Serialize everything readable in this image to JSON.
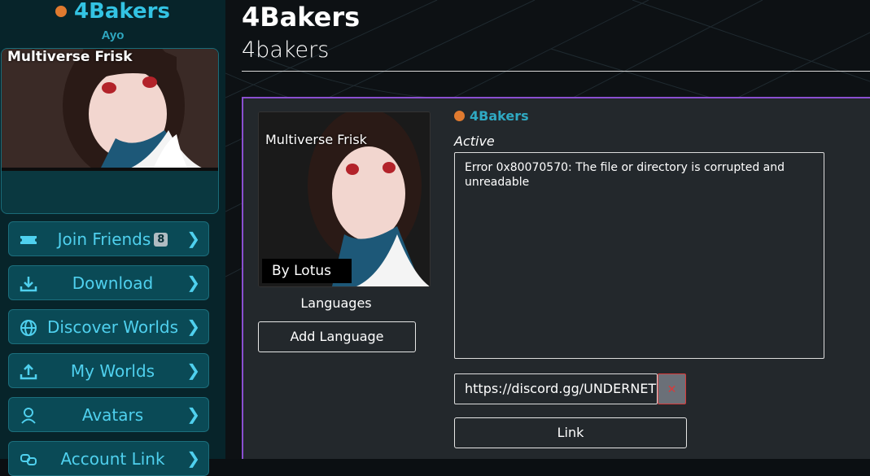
{
  "sidebar": {
    "user_name": "4Bakers",
    "status_text": "Ayo",
    "status_color": "#e07a2f",
    "avatar_name": "Multiverse Frisk",
    "nav": [
      {
        "label": "Join Friends",
        "icon": "ticket-icon",
        "badge": "8"
      },
      {
        "label": "Download",
        "icon": "download-icon"
      },
      {
        "label": "Discover Worlds",
        "icon": "globe-icon"
      },
      {
        "label": "My Worlds",
        "icon": "upload-icon"
      },
      {
        "label": "Avatars",
        "icon": "avatar-icon"
      },
      {
        "label": "Account Link",
        "icon": "link-icon"
      }
    ]
  },
  "main": {
    "title": "4Bakers",
    "subtitle": "4bakers",
    "panel": {
      "thumbnail_title": "Multiverse Frisk",
      "thumbnail_credit": "By Lotus",
      "languages_label": "Languages",
      "add_language_label": "Add Language",
      "display_name": "4Bakers",
      "status": "Active",
      "bio": "Error 0x80070570: The file or directory is corrupted and unreadable",
      "link_value": "https://discord.gg/UNDERNET",
      "link_remove_icon": "close-icon",
      "link_button_label": "Link"
    }
  },
  "colors": {
    "accent": "#33c3e3",
    "panel_border": "#8a4fd0",
    "sidebar_bg": "#07242a",
    "nav_bg": "#0a4a56"
  }
}
